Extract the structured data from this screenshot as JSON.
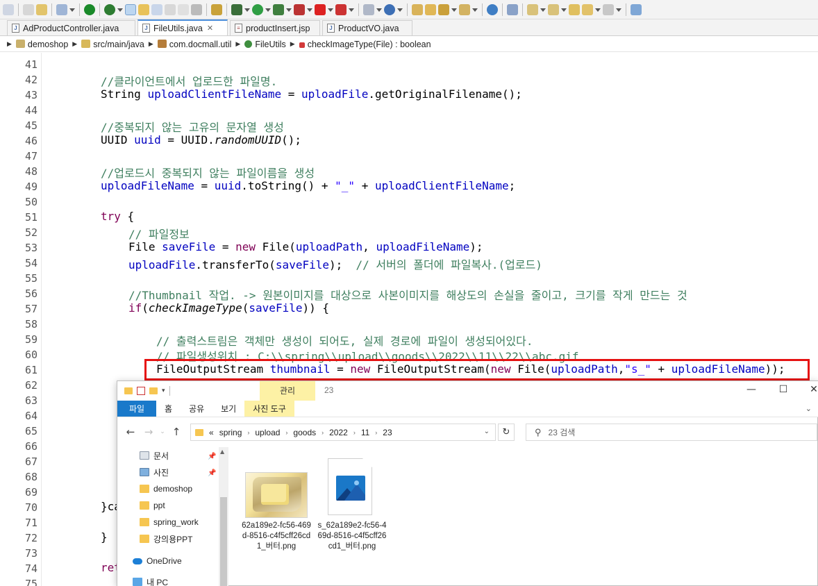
{
  "tabs": [
    {
      "label": "AdProductController.java",
      "icon": "java-file-icon",
      "active": false
    },
    {
      "label": "FileUtils.java",
      "icon": "java-file-icon",
      "active": true,
      "close": "✕"
    },
    {
      "label": "productInsert.jsp",
      "icon": "jsp-file-icon",
      "active": false
    },
    {
      "label": "ProductVO.java",
      "icon": "java-file-icon",
      "active": false
    }
  ],
  "breadcrumb": [
    "demoshop",
    "src/main/java",
    "com.docmall.util",
    "FileUtils",
    "checkImageType(File) : boolean"
  ],
  "editor": {
    "lines": [
      {
        "n": "41"
      },
      {
        "n": "42"
      },
      {
        "n": "43"
      },
      {
        "n": "44"
      },
      {
        "n": "45"
      },
      {
        "n": "46"
      },
      {
        "n": "47"
      },
      {
        "n": "48"
      },
      {
        "n": "49"
      },
      {
        "n": "50"
      },
      {
        "n": "51"
      },
      {
        "n": "52"
      },
      {
        "n": "53"
      },
      {
        "n": "54"
      },
      {
        "n": "55"
      },
      {
        "n": "56"
      },
      {
        "n": "57"
      },
      {
        "n": "58"
      },
      {
        "n": "59"
      },
      {
        "n": "60"
      },
      {
        "n": "61"
      },
      {
        "n": "62"
      },
      {
        "n": "63"
      },
      {
        "n": "64"
      },
      {
        "n": "65"
      },
      {
        "n": "66"
      },
      {
        "n": "67"
      },
      {
        "n": "68"
      },
      {
        "n": "69"
      },
      {
        "n": "70"
      },
      {
        "n": "71"
      },
      {
        "n": "72"
      },
      {
        "n": "73"
      },
      {
        "n": "74"
      },
      {
        "n": "75"
      }
    ],
    "code": {
      "c42": "//클라이언트에서 업로드한 파일명.",
      "l43a": "String ",
      "l43b": "uploadClientFileName",
      "l43c": " = ",
      "l43d": "uploadFile",
      "l43e": ".getOriginalFilename();",
      "c45": "//중복되지 않는 고유의 문자열 생성",
      "l46a": "UUID ",
      "l46b": "uuid",
      "l46c": " = UUID.",
      "l46d": "randomUUID",
      "l46e": "();",
      "c48": "//업로드시 중복되지 않는 파일이름을 생성",
      "l49a": "uploadFileName",
      "l49b": " = ",
      "l49c": "uuid",
      "l49d": ".toString() + ",
      "l49e": "\"_\"",
      "l49f": " + ",
      "l49g": "uploadClientFileName",
      "l49h": ";",
      "l51a": "try",
      "l51b": " {",
      "c52": "// 파일정보",
      "l53a": "File ",
      "l53b": "saveFile",
      "l53c": " = ",
      "l53d": "new",
      "l53e": " File(",
      "l53f": "uploadPath",
      "l53g": ", ",
      "l53h": "uploadFileName",
      "l53i": ");",
      "l54a": "uploadFile",
      "l54b": ".transferTo(",
      "l54c": "saveFile",
      "l54d": ");  ",
      "l54e": "// 서버의 폴더에 파일복사.(업로드)",
      "c56": "//Thumbnail 작업. -> 원본이미지를 대상으로 사본이미지를 해상도의 손실을 줄이고, 크기를 작게 만드는 것",
      "l57a": "if",
      "l57b": "(",
      "l57c": "checkImageType",
      "l57d": "(",
      "l57e": "saveFile",
      "l57f": ")) {",
      "c59": "// 출력스트림은 객체만 생성이 되어도, 실제 경로에 파일이 생성되어있다.",
      "c60": "// 파일생성위치 : C:\\\\spring\\\\upload\\\\goods\\\\2022\\\\11\\\\22\\\\abc.gif",
      "l61a": "FileOutputStream ",
      "l61b": "thumbnail",
      "l61c": " = ",
      "l61d": "new",
      "l61e": " FileOutputStream(",
      "l61f": "new",
      "l61g": " File(",
      "l61h": "uploadPath",
      "l61i": ",",
      "l61j": "\"s_\"",
      "l61k": " + ",
      "l61l": "uploadFileName",
      "l61m": "));",
      "l70a": "}ca",
      "l72a": "}",
      "l74a": "ret"
    }
  },
  "explorer": {
    "manage_label": "관리",
    "photo_tools_label": "사진 도구",
    "title_fragment": "23",
    "ribbon_tabs": [
      "파일",
      "홈",
      "공유",
      "보기"
    ],
    "window_buttons": {
      "minimize": "—",
      "maximize": "☐",
      "close": "✕"
    },
    "address_prefix": "«",
    "address": [
      "spring",
      "upload",
      "goods",
      "2022",
      "11",
      "23"
    ],
    "search_placeholder": "23 검색",
    "sidebar": [
      {
        "label": "문서",
        "icon": "documents-icon",
        "pinned": true
      },
      {
        "label": "사진",
        "icon": "pictures-icon",
        "pinned": true
      },
      {
        "label": "demoshop",
        "icon": "folder-icon"
      },
      {
        "label": "ppt",
        "icon": "folder-icon"
      },
      {
        "label": "spring_work",
        "icon": "folder-icon"
      },
      {
        "label": "강의용PPT",
        "icon": "folder-icon"
      },
      {
        "label": "OneDrive",
        "icon": "onedrive-icon"
      },
      {
        "label": "내 PC",
        "icon": "pc-icon"
      }
    ],
    "files": [
      {
        "name": "62a189e2-fc56-469d-8516-c4f5cff26cd1_버터.png",
        "thumb": "butter-photo"
      },
      {
        "name": "s_62a189e2-fc56-469d-8516-c4f5cff26cd1_버터.png",
        "thumb": "image-file-icon"
      }
    ]
  },
  "colors": {
    "comment": "#3f7f5f",
    "keyword": "#7f0055",
    "field": "#0000c0",
    "string": "#2a00ff",
    "highlight": "#e61212",
    "ribbon_file": "#1979ca",
    "manage_bg": "#fdf1a5"
  }
}
